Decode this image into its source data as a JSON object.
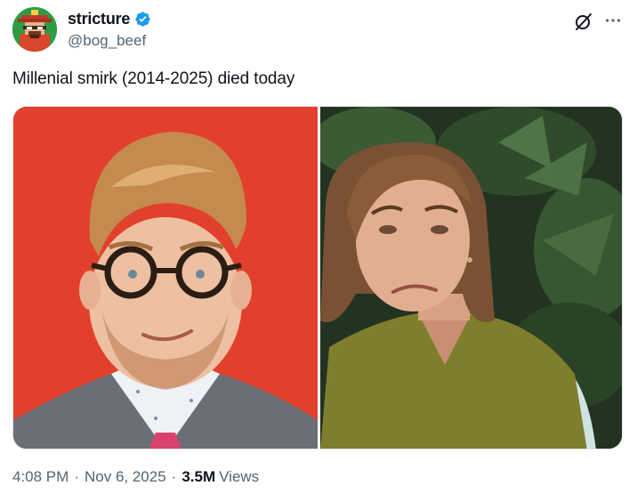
{
  "author": {
    "display_name": "stricture",
    "handle": "@bog_beef",
    "verified": true,
    "avatar_icon": "pixel-art-avatar"
  },
  "header_actions": {
    "grok_icon": "grok-icon",
    "more_icon": "more-options-icon"
  },
  "tweet": {
    "text": "Millenial smirk (2014-2025) died today"
  },
  "media": {
    "left_photo": "smiling-man-glasses-red-background",
    "right_photo": "woman-grimacing-green-foliage"
  },
  "meta": {
    "time": "4:08 PM",
    "date": "Nov 6, 2025",
    "views_count": "3.5M",
    "views_label": "Views",
    "separator": "·"
  },
  "colors": {
    "verified_blue": "#1d9bf0",
    "secondary_text": "#536471",
    "primary_text": "#0f1419"
  }
}
